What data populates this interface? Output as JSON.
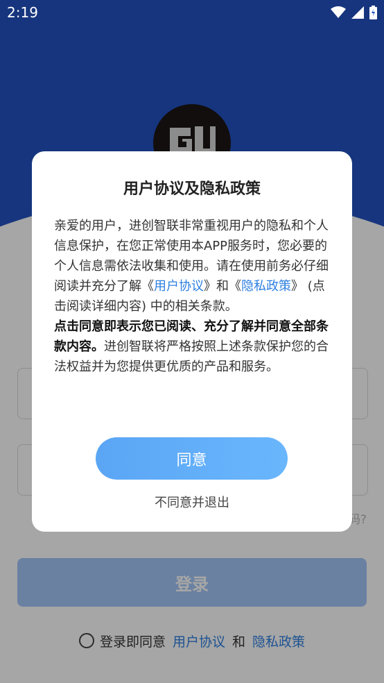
{
  "status_bar": {
    "time": "2:19"
  },
  "login": {
    "button_label": "登录",
    "forgot_partial": "码?",
    "agree_prefix": "登录即同意",
    "terms_link": "用户协议",
    "and": "和",
    "privacy_link": "隐私政策"
  },
  "dialog": {
    "title": "用户协议及隐私政策",
    "p1_a": "亲爱的用户，进创智联非常重视用户的隐私和个人信息保护，在您正常使用本APP服务时，您必要的个人信息需依法收集和使用。请在使用前务必仔细阅读并充分了解《",
    "p1_terms": "用户协议",
    "p1_b": "》和《",
    "p1_privacy": "隐私政策",
    "p1_c": "》 (点击阅读详细内容) 中的相关条款。",
    "p2_bold": "点击同意即表示您已阅读、充分了解并同意全部条款内容。",
    "p2_rest": "进创智联将严格按照上述条款保护您的合法权益并为您提供更优质的产品和服务。",
    "agree_label": "同意",
    "disagree_label": "不同意并退出"
  },
  "colors": {
    "header_blue": "#2352c2",
    "link_blue": "#2d7fe0",
    "agree_button": "#5aa6f5"
  }
}
